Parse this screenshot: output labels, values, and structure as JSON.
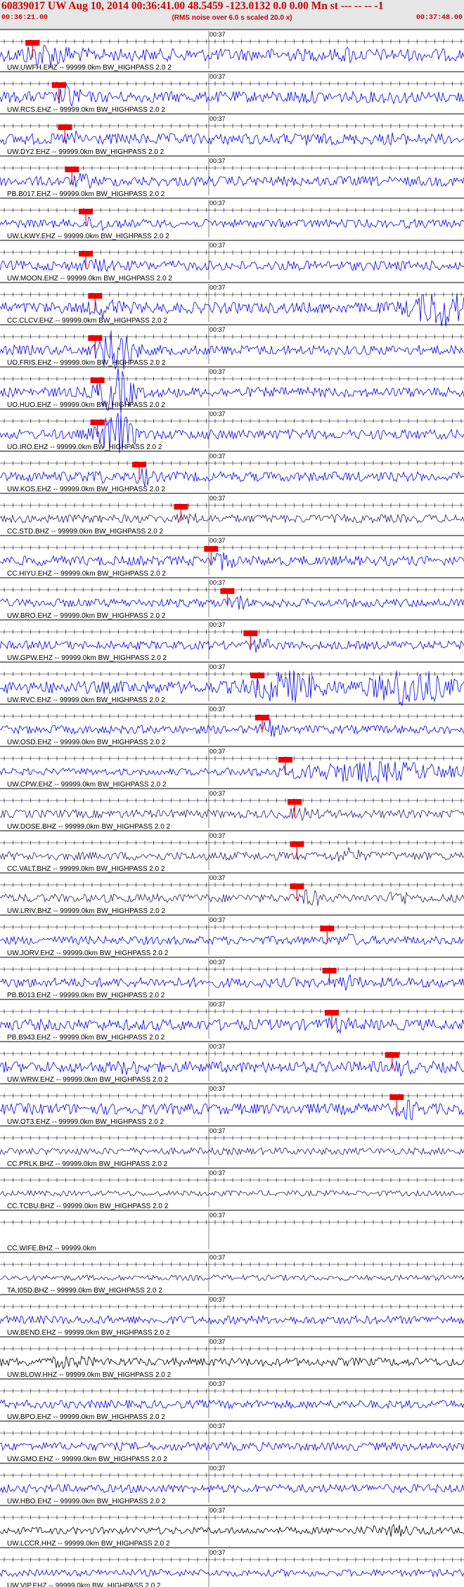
{
  "header": {
    "title": "60839017 UW Aug 10, 2014 00:36:41.00   48.5459 -123.0132  0.0 0.00 Mn st --- -- --  -1",
    "start_time": "00:36:21.00",
    "subtitle": "(RMS noise over 6.0 s scaled 20.0 x)",
    "end_time": "00:37:48.00"
  },
  "colors": {
    "header_bg": "#e6e6e6",
    "header_text": "#cc0000",
    "trace_blue": "#0000ee",
    "trace_purple": "#2a1a6a",
    "trace_black": "#000000",
    "pick": "#ee0000"
  },
  "chart_data": {
    "type": "seismogram",
    "time_axis": {
      "start": "00:36:21.00",
      "end": "00:37:48.00",
      "marker_label": "00:37"
    },
    "series": [
      {
        "name": "UW.UWFH.EHZ -- 99999.0km BW_HIGHPASS  2.0  2",
        "color": "blue",
        "pick": true,
        "pick_pos": 0.07,
        "amp": 9,
        "events": [
          {
            "p": 0.1,
            "a": 2.2,
            "w": 0.05
          },
          {
            "p": 0.75,
            "a": 1.6,
            "w": 0.01
          }
        ]
      },
      {
        "name": "UW.RCS.EHZ -- 99999.0km BW_HIGHPASS  2.0  2",
        "color": "blue",
        "pick": true,
        "pick_pos": 0.127,
        "amp": 8,
        "events": [
          {
            "p": 0.15,
            "a": 2.6,
            "w": 0.02
          },
          {
            "p": 0.65,
            "a": 1.3,
            "w": 0.03
          },
          {
            "p": 0.85,
            "a": 1.3,
            "w": 0.03
          }
        ]
      },
      {
        "name": "UW.DY2.EHZ -- 99999.0km BW_HIGHPASS  2.0  2",
        "color": "blue",
        "pick": true,
        "pick_pos": 0.14,
        "amp": 8,
        "events": [
          {
            "p": 0.16,
            "a": 1.6,
            "w": 0.02
          },
          {
            "p": 0.66,
            "a": 2.2,
            "w": 0.006
          },
          {
            "p": 0.85,
            "a": 1.8,
            "w": 0.006
          }
        ]
      },
      {
        "name": "PB.B017.EHZ -- 99999.0km BW_HIGHPASS  2.0  2",
        "color": "blue",
        "pick": true,
        "pick_pos": 0.155,
        "amp": 7,
        "events": [
          {
            "p": 0.18,
            "a": 1.8,
            "w": 0.02
          }
        ]
      },
      {
        "name": "UW.LKWY.EHZ -- 99999.0km BW_HIGHPASS  2.0  2",
        "color": "blue",
        "pick": true,
        "pick_pos": 0.185,
        "amp": 6,
        "events": [
          {
            "p": 0.21,
            "a": 2.4,
            "w": 0.02
          },
          {
            "p": 0.88,
            "a": 1.3,
            "w": 0.006
          }
        ]
      },
      {
        "name": "UW.MOON.EHZ -- 99999.0km BW_HIGHPASS  2.0  2",
        "color": "blue",
        "pick": true,
        "pick_pos": 0.185,
        "amp": 7,
        "events": [
          {
            "p": 0.21,
            "a": 1.5,
            "w": 0.03
          }
        ]
      },
      {
        "name": "CC.CLCV.EHZ -- 99999.0km BW_HIGHPASS  2.0  2",
        "color": "blue",
        "pick": true,
        "pick_pos": 0.205,
        "amp": 8,
        "events": [
          {
            "p": 0.23,
            "a": 2.0,
            "w": 0.03
          },
          {
            "p": 0.95,
            "a": 3.6,
            "w": 0.06
          }
        ]
      },
      {
        "name": "UO.FRIS.EHZ -- 99999.0km BW_HIGHPASS  2.0  2",
        "color": "blue",
        "pick": true,
        "pick_pos": 0.205,
        "amp": 7,
        "events": [
          {
            "p": 0.25,
            "a": 5.0,
            "w": 0.035
          }
        ]
      },
      {
        "name": "UO.HUO.EHZ -- 99999.0km BW_HIGHPASS  2.0  2",
        "color": "blue",
        "pick": true,
        "pick_pos": 0.21,
        "amp": 7,
        "events": [
          {
            "p": 0.25,
            "a": 5.0,
            "w": 0.035
          }
        ]
      },
      {
        "name": "UO.IRO.EHZ -- 99999.0km BW_HIGHPASS  2.0  2",
        "color": "blue",
        "pick": true,
        "pick_pos": 0.21,
        "amp": 7,
        "events": [
          {
            "p": 0.25,
            "a": 5.0,
            "w": 0.035
          }
        ]
      },
      {
        "name": "UW.KOS.EHZ -- 99999.0km BW_HIGHPASS  2.0  2",
        "color": "blue",
        "pick": true,
        "pick_pos": 0.3,
        "amp": 7,
        "events": [
          {
            "p": 0.21,
            "a": 1.8,
            "w": 0.015
          },
          {
            "p": 0.31,
            "a": 2.2,
            "w": 0.015
          }
        ]
      },
      {
        "name": "CC.STD.BHZ -- 99999.0km BW_HIGHPASS  2.0  2",
        "color": "purple",
        "pick": true,
        "pick_pos": 0.39,
        "amp": 6,
        "events": [
          {
            "p": 0.41,
            "a": 1.6,
            "w": 0.02
          }
        ]
      },
      {
        "name": "CC.HIYU.EHZ -- 99999.0km BW_HIGHPASS  2.0  2",
        "color": "blue",
        "pick": true,
        "pick_pos": 0.455,
        "amp": 7,
        "events": [
          {
            "p": 0.48,
            "a": 2.2,
            "w": 0.02
          }
        ]
      },
      {
        "name": "UW.BRO.EHZ -- 99999.0km BW_HIGHPASS  2.0  2",
        "color": "blue",
        "pick": true,
        "pick_pos": 0.49,
        "amp": 6,
        "events": [
          {
            "p": 0.51,
            "a": 2.6,
            "w": 0.015
          }
        ]
      },
      {
        "name": "UW.GPW.EHZ -- 99999.0km BW_HIGHPASS  2.0  2",
        "color": "blue",
        "pick": true,
        "pick_pos": 0.54,
        "amp": 6,
        "events": [
          {
            "p": 0.56,
            "a": 2.0,
            "w": 0.02
          },
          {
            "p": 0.88,
            "a": 1.2,
            "w": 0.006
          }
        ]
      },
      {
        "name": "UW.RVC.EHZ -- 99999.0km BW_HIGHPASS  2.0  2",
        "color": "blue",
        "pick": true,
        "pick_pos": 0.555,
        "amp": 9,
        "events": [
          {
            "p": 0.62,
            "a": 2.8,
            "w": 0.07
          },
          {
            "p": 0.88,
            "a": 3.4,
            "w": 0.07
          }
        ]
      },
      {
        "name": "UW.OSD.EHZ -- 99999.0km BW_HIGHPASS  2.0  2",
        "color": "blue",
        "pick": true,
        "pick_pos": 0.565,
        "amp": 6,
        "events": [
          {
            "p": 0.58,
            "a": 2.6,
            "w": 0.015
          }
        ]
      },
      {
        "name": "UW.CPW.EHZ -- 99999.0km BW_HIGHPASS  2.0  2",
        "color": "blue",
        "pick": true,
        "pick_pos": 0.615,
        "amp": 5,
        "events": [
          {
            "p": 0.8,
            "a": 3.2,
            "w": 0.18
          }
        ]
      },
      {
        "name": "UW.DOSE.BHZ -- 99999.0km BW_HIGHPASS  2.0  2",
        "color": "purple",
        "pick": true,
        "pick_pos": 0.635,
        "amp": 6,
        "events": [
          {
            "p": 0.65,
            "a": 1.8,
            "w": 0.03
          }
        ]
      },
      {
        "name": "CC.VALT.BHZ -- 99999.0km BW_HIGHPASS  2.0  2",
        "color": "purple",
        "pick": true,
        "pick_pos": 0.64,
        "amp": 6,
        "events": [
          {
            "p": 0.75,
            "a": 2.2,
            "w": 0.025
          }
        ]
      },
      {
        "name": "UW.LRIV.BHZ -- 99999.0km BW_HIGHPASS  2.0  2",
        "color": "purple",
        "pick": true,
        "pick_pos": 0.64,
        "amp": 6,
        "events": [
          {
            "p": 0.67,
            "a": 2.4,
            "w": 0.02
          },
          {
            "p": 0.86,
            "a": 2.2,
            "w": 0.02
          }
        ]
      },
      {
        "name": "UW.JORV.EHZ -- 99999.0km BW_HIGHPASS  2.0  2",
        "color": "blue",
        "pick": true,
        "pick_pos": 0.705,
        "amp": 6,
        "events": [
          {
            "p": 0.75,
            "a": 1.8,
            "w": 0.02
          }
        ]
      },
      {
        "name": "PB.B013.EHZ -- 99999.0km BW_HIGHPASS  2.0  2",
        "color": "blue",
        "pick": true,
        "pick_pos": 0.71,
        "amp": 7,
        "events": [
          {
            "p": 0.75,
            "a": 2.0,
            "w": 0.02
          }
        ]
      },
      {
        "name": "PB.B943.EHZ -- 99999.0km BW_HIGHPASS  2.0  2",
        "color": "blue",
        "pick": true,
        "pick_pos": 0.715,
        "amp": 8,
        "events": [
          {
            "p": 0.73,
            "a": 1.6,
            "w": 0.02
          }
        ]
      },
      {
        "name": "UW.WRW.EHZ -- 99999.0km BW_HIGHPASS  2.0  2",
        "color": "blue",
        "pick": true,
        "pick_pos": 0.845,
        "amp": 8,
        "events": [
          {
            "p": 0.28,
            "a": 1.5,
            "w": 0.03
          },
          {
            "p": 0.87,
            "a": 1.8,
            "w": 0.015
          }
        ]
      },
      {
        "name": "UW.OT3.EHZ -- 99999.0km BW_HIGHPASS  2.0  2",
        "color": "blue",
        "pick": true,
        "pick_pos": 0.855,
        "amp": 8,
        "events": [
          {
            "p": 0.88,
            "a": 2.2,
            "w": 0.02
          }
        ]
      },
      {
        "name": "CC.PRLK.BHZ -- 99999.0km BW_HIGHPASS  2.0  2",
        "color": "purple",
        "pick": false,
        "amp": 5,
        "events": []
      },
      {
        "name": "CC.TCBU.BHZ -- 99999.0km BW_HIGHPASS  2.0  2",
        "color": "purple",
        "pick": false,
        "amp": 4,
        "events": []
      },
      {
        "name": "CC.WIFE.BHZ -- 99999.0km",
        "color": "blue",
        "pick": false,
        "amp": 0,
        "events": []
      },
      {
        "name": "TA.I05D.BHZ -- 99999.0km BW_HIGHPASS  2.0  2",
        "color": "purple",
        "pick": false,
        "amp": 4,
        "events": []
      },
      {
        "name": "UW.BEND.EHZ -- 99999.0km BW_HIGHPASS  2.0  2",
        "color": "blue",
        "pick": false,
        "amp": 6,
        "events": []
      },
      {
        "name": "UW.BLOW.HHZ -- 99999.0km BW_HIGHPASS  2.0  2",
        "color": "black",
        "pick": false,
        "amp": 6,
        "events": [
          {
            "p": 0.15,
            "a": 1.6,
            "w": 0.05
          }
        ]
      },
      {
        "name": "UW.BPO.EHZ -- 99999.0km BW_HIGHPASS  2.0  2",
        "color": "blue",
        "pick": false,
        "amp": 6,
        "events": []
      },
      {
        "name": "UW.GMO.EHZ -- 99999.0km BW_HIGHPASS  2.0  2",
        "color": "blue",
        "pick": false,
        "amp": 6,
        "events": []
      },
      {
        "name": "UW.HBO.EHZ -- 99999.0km BW_HIGHPASS  2.0  2",
        "color": "blue",
        "pick": false,
        "amp": 6,
        "events": []
      },
      {
        "name": "UW.LCCR.HHZ -- 99999.0km BW_HIGHPASS  2.0  2",
        "color": "black",
        "pick": false,
        "amp": 5,
        "events": [
          {
            "p": 0.85,
            "a": 1.8,
            "w": 0.06
          }
        ]
      },
      {
        "name": "UW.VIP.EHZ -- 99999.0km BW_HIGHPASS  2.0  2",
        "color": "blue",
        "pick": false,
        "amp": 5,
        "events": []
      }
    ]
  }
}
